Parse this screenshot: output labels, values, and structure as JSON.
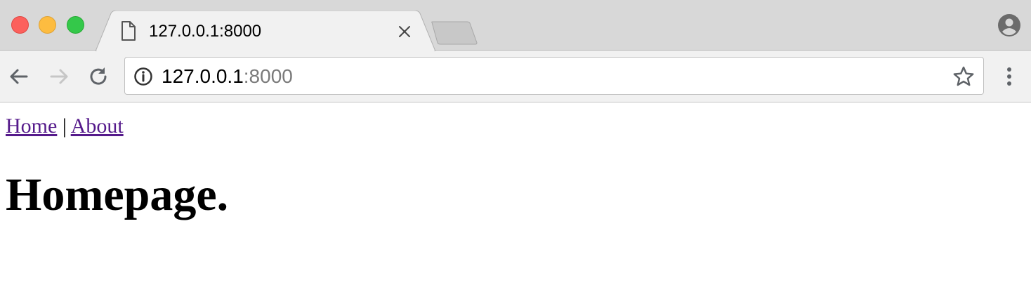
{
  "window": {
    "tab": {
      "title": "127.0.0.1:8000",
      "icon": "page-icon",
      "close_icon": "close-icon"
    },
    "new_tab_icon": "new-tab-icon",
    "profile_icon": "profile-icon"
  },
  "toolbar": {
    "back_icon": "back-arrow-icon",
    "forward_icon": "forward-arrow-icon",
    "reload_icon": "reload-icon",
    "address": {
      "host": "127.0.0.1",
      "port": ":8000",
      "info_icon": "info-icon",
      "bookmark_icon": "star-icon"
    },
    "menu_icon": "kebab-menu-icon"
  },
  "page": {
    "nav": {
      "home": "Home",
      "separator": " | ",
      "about": "About"
    },
    "heading": "Homepage."
  },
  "colors": {
    "tab_strip": "#d8d8d8",
    "toolbar": "#f1f1f1",
    "visited_link": "#551a8b",
    "close_red": "#fc605c",
    "minimize_yellow": "#fdbc40",
    "zoom_green": "#34c84a",
    "url_port_gray": "#7a7a7a"
  }
}
